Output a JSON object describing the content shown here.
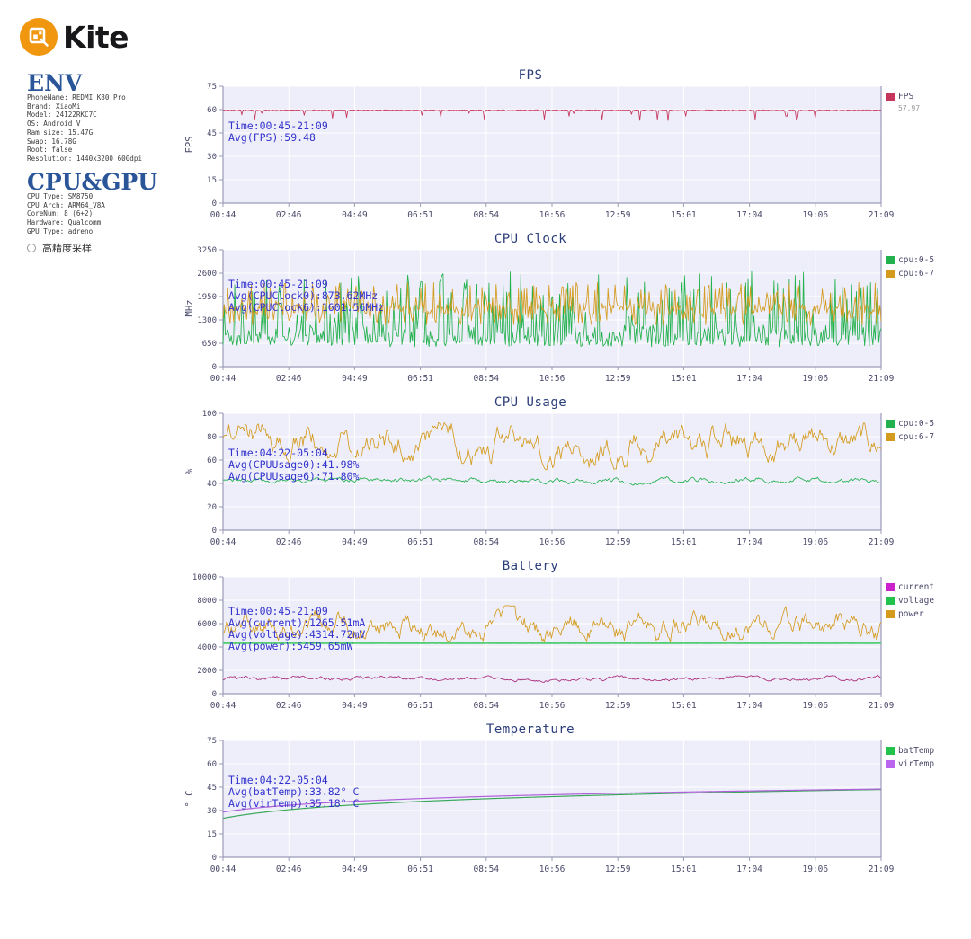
{
  "app": {
    "logo_text": "Kite",
    "logo_icon": "kite-magnifier-icon",
    "logo_color": "#f0960f"
  },
  "sidebar": {
    "env": {
      "title": "ENV",
      "lines": [
        "PhoneName: REDMI K80 Pro",
        "Brand: XiaoMi",
        "Model: 24122RKC7C",
        "OS: Android V",
        "Ram size: 15.47G",
        "Swap: 16.78G",
        "Root: false",
        "Resolution: 1440x3200 600dpi"
      ]
    },
    "cpugpu": {
      "title": "CPU&GPU",
      "lines": [
        "CPU Type: SM8750",
        "CPU Arch: ARM64_V8A",
        "CoreNum: 8 (6+2)",
        "Hardware: Qualcomm",
        "GPU Type: adreno"
      ]
    },
    "option": {
      "label": "高精度采样",
      "checked": false,
      "icon": "radio-unchecked-icon"
    }
  },
  "chart_data": [
    {
      "type": "line",
      "title": "FPS",
      "ylabel": "FPS",
      "xlabel": "",
      "ylim": [
        0,
        75
      ],
      "yticks": [
        0,
        15,
        30,
        45,
        60,
        75
      ],
      "xticks": [
        "00:44",
        "02:46",
        "04:49",
        "06:51",
        "08:54",
        "10:56",
        "12:59",
        "15:01",
        "17:04",
        "19:06",
        "21:09"
      ],
      "grid": true,
      "annotations": [
        "Time:00:45-21:09",
        "Avg(FPS):59.48"
      ],
      "legend_position": "right",
      "legend": [
        {
          "name": "FPS",
          "color": "#c6355c",
          "value": "57.97"
        }
      ],
      "series": [
        {
          "name": "FPS",
          "color": "#c6355c",
          "baseline": 59.6,
          "noise": 0.55,
          "dip_depth": 6.5,
          "dip_rate": 0.055,
          "values": [
            59.7,
            59.5,
            59.4,
            59.6,
            59.5,
            58.2,
            59.6,
            59.4,
            59.5,
            59.6,
            59.3,
            59.5,
            59.6,
            57.0,
            59.5,
            59.4,
            59.6,
            59.5,
            59.4,
            59.6
          ]
        }
      ]
    },
    {
      "type": "line",
      "title": "CPU Clock",
      "ylabel": "MHz",
      "xlabel": "",
      "ylim": [
        0,
        3250
      ],
      "yticks": [
        0,
        650,
        1300,
        1950,
        2600,
        3250
      ],
      "xticks": [
        "00:44",
        "02:46",
        "04:49",
        "06:51",
        "08:54",
        "10:56",
        "12:59",
        "15:01",
        "17:04",
        "19:06",
        "21:09"
      ],
      "grid": true,
      "annotations": [
        "Time:00:45-21:09",
        "Avg(CPUClock0):873.62MHz",
        "Avg(CPUClock6):1601.56MHz"
      ],
      "legend_position": "right",
      "legend": [
        {
          "name": "cpu:0-5",
          "color": "#22b14c"
        },
        {
          "name": "cpu:6-7",
          "color": "#d49b1e"
        }
      ],
      "series": [
        {
          "name": "cpu:0-5",
          "color": "#22b14c",
          "mean": 873.62,
          "low": 550,
          "high": 2650,
          "spiky": true
        },
        {
          "name": "cpu:6-7",
          "color": "#d49b1e",
          "mean": 1601.56,
          "low": 1150,
          "high": 2350,
          "spiky": true
        }
      ]
    },
    {
      "type": "line",
      "title": "CPU Usage",
      "ylabel": "%",
      "xlabel": "",
      "ylim": [
        0,
        100
      ],
      "yticks": [
        0,
        20,
        40,
        60,
        80,
        100
      ],
      "xticks": [
        "00:44",
        "02:46",
        "04:49",
        "06:51",
        "08:54",
        "10:56",
        "12:59",
        "15:01",
        "17:04",
        "19:06",
        "21:09"
      ],
      "grid": true,
      "annotations": [
        "Time:04:22-05:04",
        "Avg(CPUUsage0):41.98%",
        "Avg(CPUUsage6):71.80%"
      ],
      "legend_position": "right",
      "legend": [
        {
          "name": "cpu:0-5",
          "color": "#22b14c"
        },
        {
          "name": "cpu:6-7",
          "color": "#d49b1e"
        }
      ],
      "series": [
        {
          "name": "cpu:0-5",
          "color": "#22b14c",
          "mean": 41.98,
          "low": 38,
          "high": 50
        },
        {
          "name": "cpu:6-7",
          "color": "#d49b1e",
          "mean": 71.8,
          "low": 55,
          "high": 88
        }
      ]
    },
    {
      "type": "line",
      "title": "Battery",
      "ylabel": "",
      "xlabel": "",
      "ylim": [
        0,
        10000
      ],
      "yticks": [
        0,
        2000,
        4000,
        6000,
        8000,
        10000
      ],
      "xticks": [
        "00:44",
        "02:46",
        "04:49",
        "06:51",
        "08:54",
        "10:56",
        "12:59",
        "15:01",
        "17:04",
        "19:06",
        "21:09"
      ],
      "grid": true,
      "annotations": [
        "Time:00:45-21:09",
        "Avg(current):1265.51mA",
        "Avg(voltage):4314.72mV",
        "Avg(power):5459.65mW"
      ],
      "legend_position": "right",
      "legend": [
        {
          "name": "current",
          "color": "#cc22cc"
        },
        {
          "name": "voltage",
          "color": "#22c24c"
        },
        {
          "name": "power",
          "color": "#d49b1e"
        }
      ],
      "series": [
        {
          "name": "current",
          "color": "#a82878",
          "mean": 1265.51,
          "low": 1050,
          "high": 1800
        },
        {
          "name": "voltage",
          "color": "#44cc66",
          "mean": 4314.72,
          "low": 4300,
          "high": 4330
        },
        {
          "name": "power",
          "color": "#d49b1e",
          "mean": 5459.65,
          "low": 4500,
          "high": 7400
        }
      ]
    },
    {
      "type": "line",
      "title": "Temperature",
      "ylabel": "° C",
      "xlabel": "",
      "ylim": [
        0,
        75
      ],
      "yticks": [
        0,
        15,
        30,
        45,
        60,
        75
      ],
      "xticks": [
        "00:44",
        "02:46",
        "04:49",
        "06:51",
        "08:54",
        "10:56",
        "12:59",
        "15:01",
        "17:04",
        "19:06",
        "21:09"
      ],
      "grid": true,
      "annotations": [
        "Time:04:22-05:04",
        "Avg(batTemp):33.82° C",
        "Avg(virTemp):35.18° C"
      ],
      "legend_position": "right",
      "legend": [
        {
          "name": "batTemp",
          "color": "#22c24c"
        },
        {
          "name": "virTemp",
          "color": "#bb66ee"
        }
      ],
      "series": [
        {
          "name": "batTemp",
          "color": "#3aa85a",
          "start": 25.0,
          "end": 43.5,
          "curve": "log"
        },
        {
          "name": "virTemp",
          "color": "#b060d8",
          "start": 29.0,
          "end": 43.8,
          "curve": "log"
        }
      ]
    }
  ],
  "layout": {
    "plot_bg": "#eeeefb",
    "grid_color": "#ffffff",
    "axis_color": "#9a9ab8",
    "tick_text_color": "#4a4a6a",
    "annotation_color": "#3333cc",
    "title_color": "#2b3e7a"
  }
}
